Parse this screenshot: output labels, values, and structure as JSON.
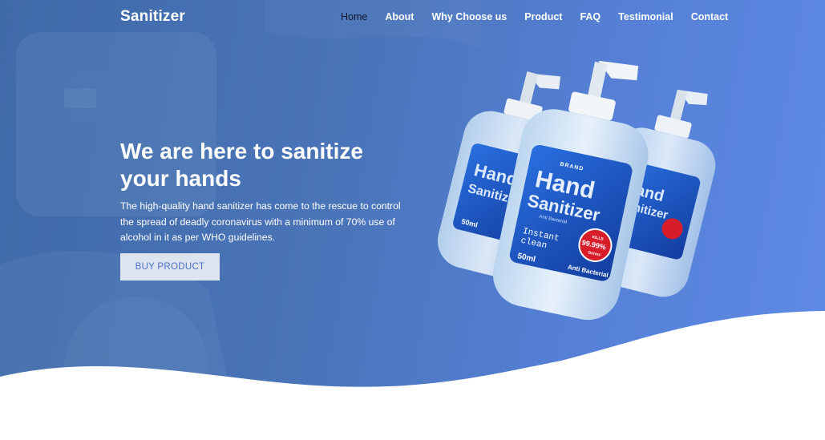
{
  "brand": {
    "name": "Sanitizer"
  },
  "nav": {
    "items": [
      {
        "label": "Home",
        "active": true
      },
      {
        "label": "About"
      },
      {
        "label": "Why Choose us"
      },
      {
        "label": "Product"
      },
      {
        "label": "FAQ"
      },
      {
        "label": "Testimonial"
      },
      {
        "label": "Contact"
      }
    ]
  },
  "hero": {
    "headline_line1": "We are here to sanitize",
    "headline_line2": "your hands",
    "description": "The high-quality hand sanitizer has come to the rescue to control the spread of deadly coronavirus with a minimum of 70% use of alcohol in it as per WHO guidelines.",
    "cta_label": "BUY PRODUCT"
  },
  "product_label": {
    "brand": "BRAND",
    "line1": "Hand",
    "line2": "Sanitizer",
    "tag": "Anti Bacterial",
    "instant1": "Instant",
    "instant2": "clean",
    "badge_top": "KILLS",
    "badge_value": "99.99%",
    "badge_bottom": "Germs",
    "volume": "50ml",
    "antibacterial": "Anti Bacterial"
  },
  "colors": {
    "hero_start": "#3f6aa8",
    "hero_end": "#5f8ae6",
    "cta_bg": "#dde4f0",
    "cta_text": "#4a74c9",
    "nav_active": "#0f1a2e",
    "label_blue": "#1d4fc4",
    "badge_red": "#d81d2a"
  }
}
